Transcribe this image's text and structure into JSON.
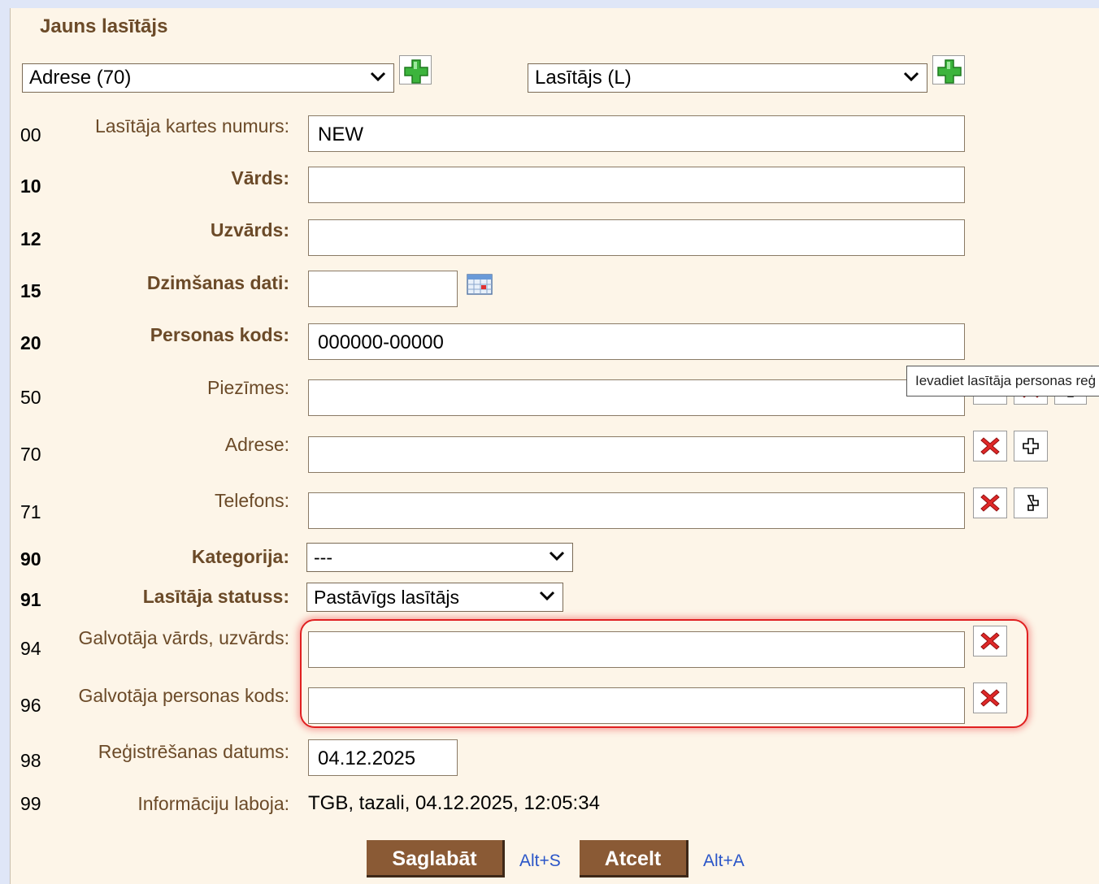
{
  "form_title": "Jauns lasītājs",
  "top": {
    "field_select": "Adrese (70)",
    "reader_type_select": "Lasītājs (L)"
  },
  "rows": {
    "r00": {
      "num": "00",
      "label": "Lasītāja kartes numurs:",
      "value": "NEW"
    },
    "r10": {
      "num": "10",
      "label": "Vārds:",
      "value": ""
    },
    "r12": {
      "num": "12",
      "label": "Uzvārds:",
      "value": ""
    },
    "r15": {
      "num": "15",
      "label": "Dzimšanas dati:",
      "value": ""
    },
    "r20": {
      "num": "20",
      "label": "Personas kods:",
      "value": "000000-00000"
    },
    "r50": {
      "num": "50",
      "label": "Piezīmes:",
      "value": ""
    },
    "r70": {
      "num": "70",
      "label": "Adrese:",
      "value": ""
    },
    "r71": {
      "num": "71",
      "label": "Telefons:",
      "value": ""
    },
    "r90": {
      "num": "90",
      "label": "Kategorija:",
      "value": "---"
    },
    "r91": {
      "num": "91",
      "label": "Lasītāja statuss:",
      "value": "Pastāvīgs lasītājs"
    },
    "r94": {
      "num": "94",
      "label": "Galvotāja vārds, uzvārds:",
      "value": ""
    },
    "r96": {
      "num": "96",
      "label": "Galvotāja personas kods:",
      "value": ""
    },
    "r98": {
      "num": "98",
      "label": "Reģistrēšanas datums:",
      "value": "04.12.2025"
    },
    "r99": {
      "num": "99",
      "label": "Informāciju laboja:",
      "value": "TGB, tazali, 04.12.2025, 12:05:34"
    }
  },
  "tooltip": "Ievadiet lasītāja personas reģ",
  "buttons": {
    "save": "Saglabāt",
    "save_shortcut": "Alt+S",
    "cancel": "Atcelt",
    "cancel_shortcut": "Alt+A"
  },
  "colors": {
    "panel": "#fdf5e8",
    "label_brown": "#6b4a28",
    "button_brown": "#8a5a35",
    "highlight_red": "#e02020",
    "link_blue": "#2a55c8"
  }
}
